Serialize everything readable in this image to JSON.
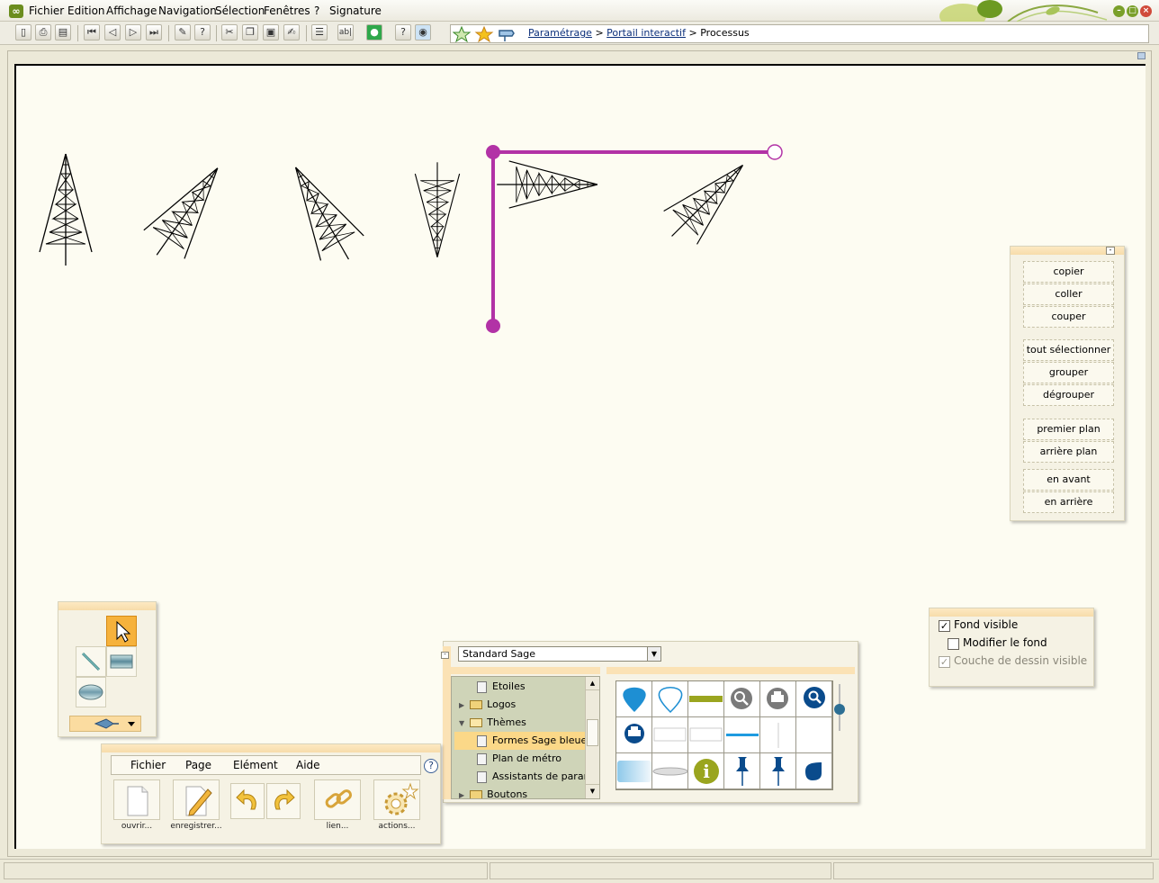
{
  "menubar": {
    "items": [
      {
        "label": "Fichier"
      },
      {
        "label": "Edition"
      },
      {
        "label": "Affichage"
      },
      {
        "label": "Navigation"
      },
      {
        "label": "Sélection"
      },
      {
        "label": "Fenêtres"
      },
      {
        "label": "?"
      },
      {
        "label": "Signature"
      }
    ]
  },
  "toolbar": {
    "icons": [
      "new-icon",
      "print-icon",
      "print-preview-icon",
      "first-page-icon",
      "previous-page-icon",
      "next-page-icon",
      "last-page-icon",
      "attach-icon",
      "help-icon",
      "cut-icon",
      "copy-icon",
      "paste-icon",
      "edit-icon",
      "form-icon",
      "text-field-icon",
      "green-circle-icon",
      "help-circle-icon",
      "web-icon"
    ]
  },
  "address": {
    "crumbs": [
      "Paramétrage",
      "Portail interactif",
      "Processus"
    ],
    "separator": ">"
  },
  "context_panel": {
    "buttons": [
      "copier",
      "coller",
      "couper",
      "tout sélectionner",
      "grouper",
      "dégrouper",
      "premier plan",
      "arrière plan",
      "en avant",
      "en arrière"
    ],
    "close": "-"
  },
  "background_panel": {
    "fond_visible": {
      "label": "Fond visible",
      "checked": true
    },
    "modifier_fond": {
      "label": "Modifier le fond",
      "checked": false
    },
    "couche_dessin": {
      "label": "Couche de dessin visible",
      "checked": true,
      "disabled": true
    }
  },
  "library": {
    "selected": "Standard Sage",
    "tree": [
      {
        "label": "Etoiles",
        "type": "page",
        "level": 2
      },
      {
        "label": "Logos",
        "type": "folder",
        "level": 1,
        "expanded": false
      },
      {
        "label": "Thèmes",
        "type": "folder",
        "level": 1,
        "expanded": true
      },
      {
        "label": "Formes Sage bleues",
        "type": "page",
        "level": 2,
        "selected": true
      },
      {
        "label": "Plan de métro",
        "type": "page",
        "level": 2
      },
      {
        "label": "Assistants de paramé",
        "type": "page",
        "level": 2
      },
      {
        "label": "Boutons",
        "type": "folder",
        "level": 1,
        "expanded": false
      }
    ]
  },
  "file_panel": {
    "menu": [
      "Fichier",
      "Page",
      "Elément",
      "Aide"
    ],
    "help": "?",
    "buttons": [
      {
        "label": "ouvrir...",
        "icon": "open-document-icon"
      },
      {
        "label": "enregistrer...",
        "icon": "save-pencil-icon"
      },
      {
        "label": "",
        "icon": "undo-icon"
      },
      {
        "label": "",
        "icon": "redo-icon"
      },
      {
        "label": "lien...",
        "icon": "link-icon"
      },
      {
        "label": "actions...",
        "icon": "actions-gear-icon"
      }
    ]
  },
  "colors": {
    "connector": "#b232a6",
    "panel_header": "#fbe2b5",
    "selection": "#fbd888",
    "accent_blue": "#0a4b8c",
    "accent_olive": "#9aa51f"
  }
}
